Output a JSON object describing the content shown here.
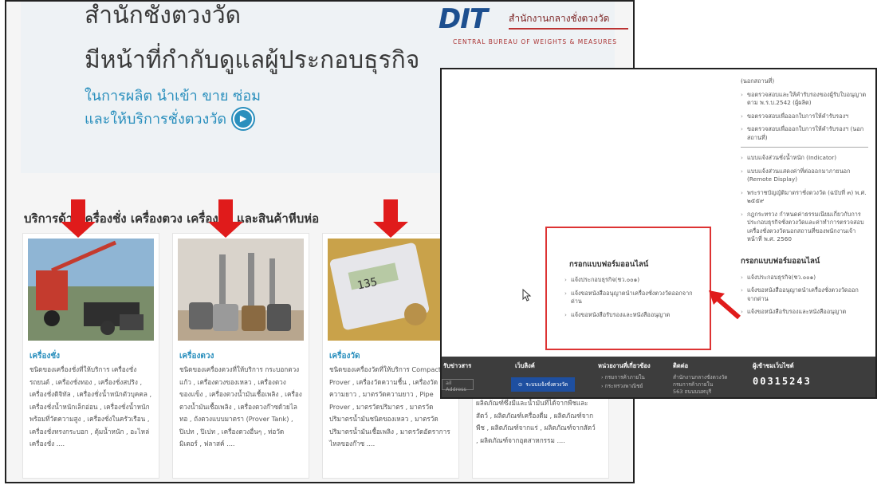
{
  "hero": {
    "line1": "สำนักชั่งตวงวัด",
    "line2": "มีหน้าที่กำกับดูแลผู้ประกอบธุรกิจ",
    "line3": "ในการผลิต นำเข้า ขาย ซ่อม",
    "line4": "และให้บริการชั่งตวงวัด"
  },
  "logo": {
    "mark": "DIT",
    "thai": "สำนักงานกลางชั่งตวงวัด",
    "english": "CENTRAL BUREAU OF WEIGHTS & MEASURES"
  },
  "services": {
    "title": "บริการด้านเครื่องชั่ง เครื่องตวง เครื่องวัด และสินค้าหีบห่อ",
    "cards": [
      {
        "title": "เครื่องชั่ง",
        "desc": "ชนิดของเครื่องชั่งที่ให้บริการ เครื่องชั่งรถยนต์ , เครื่องชั่งทอง , เครื่องชั่งสปริง , เครื่องชั่งดิจิทัล , เครื่องชั่งน้ำหนักตัวบุคคล , เครื่องชั่งน้ำหนักเล็กอ่อน , เครื่องชั่งน้ำหนักพร้อมที่วัดความสูง , เครื่องชั่งในครัวเรือน , เครื่องชั่งทรงกระบอก , ตุ้มน้ำหนัก , อะไหล่เครื่องชั่ง ...."
      },
      {
        "title": "เครื่องตวง",
        "desc": "ชนิดของเครื่องตวงที่ให้บริการ กระบอกตวงแก้ว , เครื่องตวงของเหลว , เครื่องตวงของแข็ง , เครื่องตวงน้ำมันเชื้อเพลิง , เครื่องตวงน้ำมันเชื้อเพลิง , เครื่องตวงก๊าซด้วยไลทอ , ถังตวงแบบมาตรา (Prover Tank) , ปิเปท , ปิเปท , เครื่องตวงอื่นๆ , ท่อวัดมิเตอร์ , ฟลาสค์ ...."
      },
      {
        "title": "เครื่องวัด",
        "desc": "ชนิดของเครื่องวัดที่ให้บริการ Compact Prover , เครื่องวัดความชื้น , เครื่องวัดความยาว , มาตรวัดความยาว , Pipe Prover , มาตรวัดปริมาตร , มาตรวัดปริมาตรน้ำมันชนิดของเหลว , มาตรวัดปริมาตรน้ำมันเชื้อเพลิง , มาตรวัดอัตราการไหลของก๊าซ ...."
      }
    ],
    "fourth_desc": "ผลิตภัณฑ์ซึ่งมีและน้ำมันที่ได้จากพืชและสัตว์ , ผลิตภัณฑ์เครื่องดื่ม , ผลิตภัณฑ์จากพืช , ผลิตภัณฑ์จากแร่ , ผลิตภัณฑ์จากสัตว์ , ผลิตภัณฑ์จากอุตสาหกรรม ...."
  },
  "sidebar": {
    "top_items": [
      "(นอกสถานที่)",
      "ขอตรวจสอบและให้คำรับรองของผู้รับใบอนุญาต ตาม พ.ร.บ.2542 (ผู้ผลิต)",
      "ขอตรวจสอบเพื่อออกใบการให้คำรับรองฯ",
      "ขอตรวจสอบเพื่อออกใบการให้คำรับรองฯ (นอกสถานที่)"
    ],
    "mid_items": [
      "แบบแจ้งส่วนชั่งน้ำหนัก (Indicator)",
      "แบบแจ้งส่วนแสดงค่าที่ต่อออกมาภายนอก (Remote Display)",
      "พระราชบัญญัติมาตราชั่งตวงวัด (ฉบับที่ ๓) พ.ศ. ๒๕๕๙",
      "กฎกระทรวง กำหนดค่าธรรมเนียมเกี่ยวกับการประกอบธุรกิจชั่งตวงวัดและค่าทำการตรวจสอบเครื่องชั่งตวงวัดนอกสถานที่ของพนักงานเจ้าหน้าที่ พ.ศ. 2560"
    ],
    "online_heading": "กรอกแบบฟอร์มออนไลน์",
    "online_items": [
      "แจ้งประกอบธุรกิจ(ชว.๐๐๑)",
      "แจ้งขอหนังสืออนุญาตนำเครื่องชั่งตวงวัดออกจากด่าน",
      "แจ้งขอหนังสือรับรองและหนังสืออนุญาต"
    ]
  },
  "redbox": {
    "heading": "กรอกแบบฟอร์มออนไลน์",
    "items": [
      "แจ้งประกอบธุรกิจ(ชว.๐๐๑)",
      "แจ้งขอหนังสืออนุญาตนำเครื่องชั่งตวงวัดออกจากด่าน",
      "แจ้งขอหนังสือรับรองและหนังสืออนุญาต"
    ]
  },
  "footer": {
    "col_news": "รับข่าวสาร",
    "email_placeholder": "ail Address",
    "col_link": "เว็บลิงค์",
    "link_button": "ระบบแจ้งชั่งตวงวัด",
    "col_agencies": "หน่วยงานที่เกี่ยวข้อง",
    "agency_1": "› กรมการค้าภายใน",
    "agency_2": "› กระทรวงพาณิชย์",
    "col_contact": "ติดต่อ",
    "contact_1": "สำนักงานกลางชั่งตวงวัด",
    "contact_2": "กรมการค้าภายใน",
    "contact_3": "563 ถนนนนทบุรี",
    "col_visitors": "ผู้เข้าชมเว็บไซต์",
    "counter": "00315243"
  },
  "colors": {
    "accent": "#2a8fbd",
    "arrow": "#e01b1b",
    "footer": "#3d3d3d"
  }
}
